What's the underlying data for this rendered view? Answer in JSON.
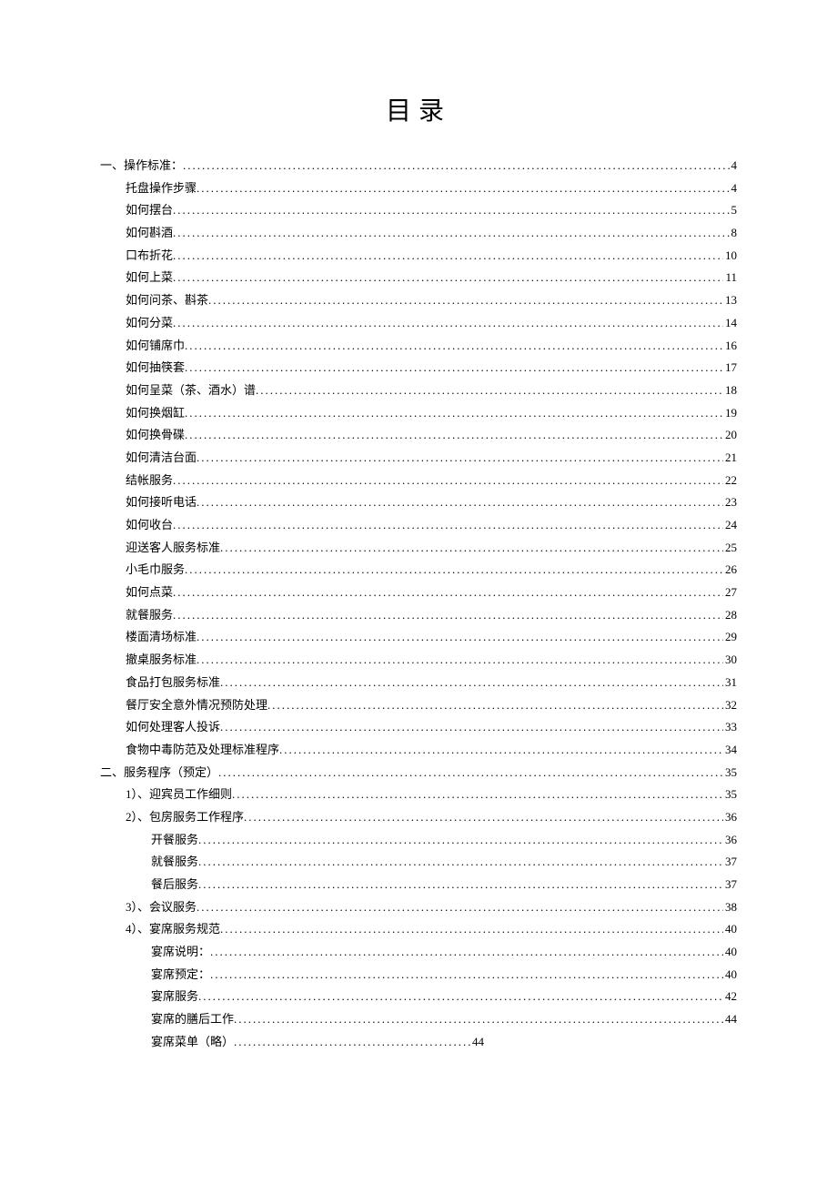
{
  "title": "目录",
  "toc": [
    {
      "label": "一、操作标准：",
      "page": "4",
      "indent": 0
    },
    {
      "label": "托盘操作步骤",
      "page": "4",
      "indent": 1
    },
    {
      "label": "如何摆台",
      "page": "5",
      "indent": 1
    },
    {
      "label": "如何斟酒",
      "page": "8",
      "indent": 1
    },
    {
      "label": "口布折花",
      "page": "10",
      "indent": 1
    },
    {
      "label": "如何上菜",
      "page": "11",
      "indent": 1
    },
    {
      "label": "如何问茶、斟茶",
      "page": "13",
      "indent": 1
    },
    {
      "label": "如何分菜",
      "page": "14",
      "indent": 1
    },
    {
      "label": "如何铺席巾",
      "page": "16",
      "indent": 1
    },
    {
      "label": "如何抽筷套",
      "page": "17",
      "indent": 1
    },
    {
      "label": "如何呈菜（茶、酒水）谱",
      "page": "18",
      "indent": 1
    },
    {
      "label": "如何换烟缸",
      "page": "19",
      "indent": 1
    },
    {
      "label": "如何换骨碟",
      "page": "20",
      "indent": 1
    },
    {
      "label": "如何清洁台面",
      "page": "21",
      "indent": 1
    },
    {
      "label": "结帐服务",
      "page": "22",
      "indent": 1
    },
    {
      "label": "如何接听电话",
      "page": "23",
      "indent": 1
    },
    {
      "label": "如何收台",
      "page": "24",
      "indent": 1
    },
    {
      "label": "迎送客人服务标准",
      "page": "25",
      "indent": 1
    },
    {
      "label": "小毛巾服务",
      "page": "26",
      "indent": 1
    },
    {
      "label": "如何点菜",
      "page": "27",
      "indent": 1
    },
    {
      "label": "就餐服务",
      "page": "28",
      "indent": 1
    },
    {
      "label": "楼面清场标准",
      "page": "29",
      "indent": 1
    },
    {
      "label": "撤桌服务标准",
      "page": "30",
      "indent": 1
    },
    {
      "label": "食品打包服务标准",
      "page": "31",
      "indent": 1
    },
    {
      "label": "餐厅安全意外情况预防处理",
      "page": "32",
      "indent": 1
    },
    {
      "label": "如何处理客人投诉",
      "page": "33",
      "indent": 1
    },
    {
      "label": "食物中毒防范及处理标准程序",
      "page": "34",
      "indent": 1
    },
    {
      "label": "二、服务程序（预定）",
      "page": "35",
      "indent": 0
    },
    {
      "label": "1）、迎宾员工作细则",
      "page": "35",
      "indent": 1
    },
    {
      "label": "2）、包房服务工作程序",
      "page": "36",
      "indent": 1
    },
    {
      "label": "开餐服务",
      "page": "36",
      "indent": 2
    },
    {
      "label": "就餐服务",
      "page": "37",
      "indent": 2
    },
    {
      "label": "餐后服务",
      "page": "37",
      "indent": 2
    },
    {
      "label": "3）、会议服务",
      "page": "38",
      "indent": 1
    },
    {
      "label": "4）、宴席服务规范",
      "page": "40",
      "indent": 1
    },
    {
      "label": "宴席说明：",
      "page": "40",
      "indent": 2
    },
    {
      "label": "宴席预定：",
      "page": "40",
      "indent": 2
    },
    {
      "label": "宴席服务",
      "page": "42",
      "indent": 2
    },
    {
      "label": "宴席的膳后工作",
      "page": "44",
      "indent": 2
    },
    {
      "label": "宴席菜单（略）",
      "page": "44",
      "indent": 2,
      "short": true
    }
  ]
}
